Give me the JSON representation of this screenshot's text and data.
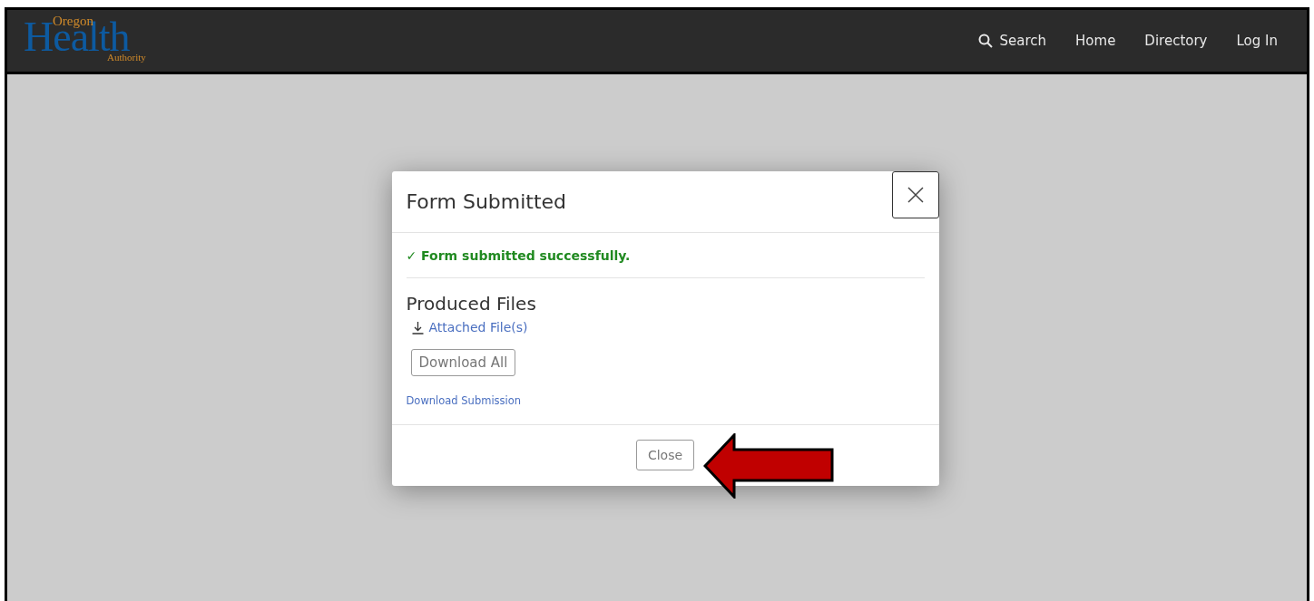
{
  "header": {
    "logo": {
      "top": "Oregon",
      "main": "Health",
      "bottom": "Authority"
    },
    "nav": [
      {
        "label": "Search",
        "kind": "search"
      },
      {
        "label": "Home",
        "kind": "link"
      },
      {
        "label": "Directory",
        "kind": "link"
      },
      {
        "label": "Log In",
        "kind": "link"
      }
    ]
  },
  "modal": {
    "title": "Form Submitted",
    "message": "✓ Form submitted successfully.",
    "section_title": "Produced Files",
    "attached_link": "Attached File(s)",
    "download_all": "Download All",
    "download_submission": "Download Submission",
    "close_button": "Close"
  }
}
